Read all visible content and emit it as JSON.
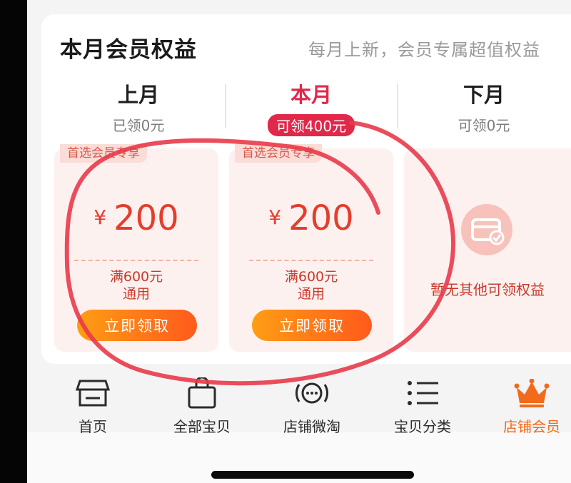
{
  "header": {
    "title": "本月会员权益",
    "subtitle": "每月上新，会员专属超值权益"
  },
  "months": [
    {
      "name": "上月",
      "status": "已领0元",
      "active": false
    },
    {
      "name": "本月",
      "status": "可领400元",
      "active": true
    },
    {
      "name": "下月",
      "status": "可领0元",
      "active": false
    }
  ],
  "coupons": [
    {
      "tag": "首选会员专享",
      "currency": "¥",
      "amount": "200",
      "condition_line1": "满600元",
      "condition_line2": "通用",
      "button": "立即领取"
    },
    {
      "tag": "首选会员专享",
      "currency": "¥",
      "amount": "200",
      "condition_line1": "满600元",
      "condition_line2": "通用",
      "button": "立即领取"
    }
  ],
  "empty_card": {
    "text": "暂无其他可领权益"
  },
  "nav": [
    {
      "label": "首页",
      "icon": "storefront-icon",
      "active": false
    },
    {
      "label": "全部宝贝",
      "icon": "shopping-bag-icon",
      "active": false
    },
    {
      "label": "店铺微淘",
      "icon": "broadcast-icon",
      "active": false
    },
    {
      "label": "宝贝分类",
      "icon": "list-icon",
      "active": false
    },
    {
      "label": "店铺会员",
      "icon": "crown-icon",
      "active": true
    }
  ],
  "colors": {
    "accent_red": "#e0284b",
    "coupon_text": "#e43d2d",
    "button_gradient_start": "#ff9d14",
    "button_gradient_end": "#ff5a1c",
    "active_nav": "#f26a1b",
    "annotation_red": "#e83a4a"
  }
}
